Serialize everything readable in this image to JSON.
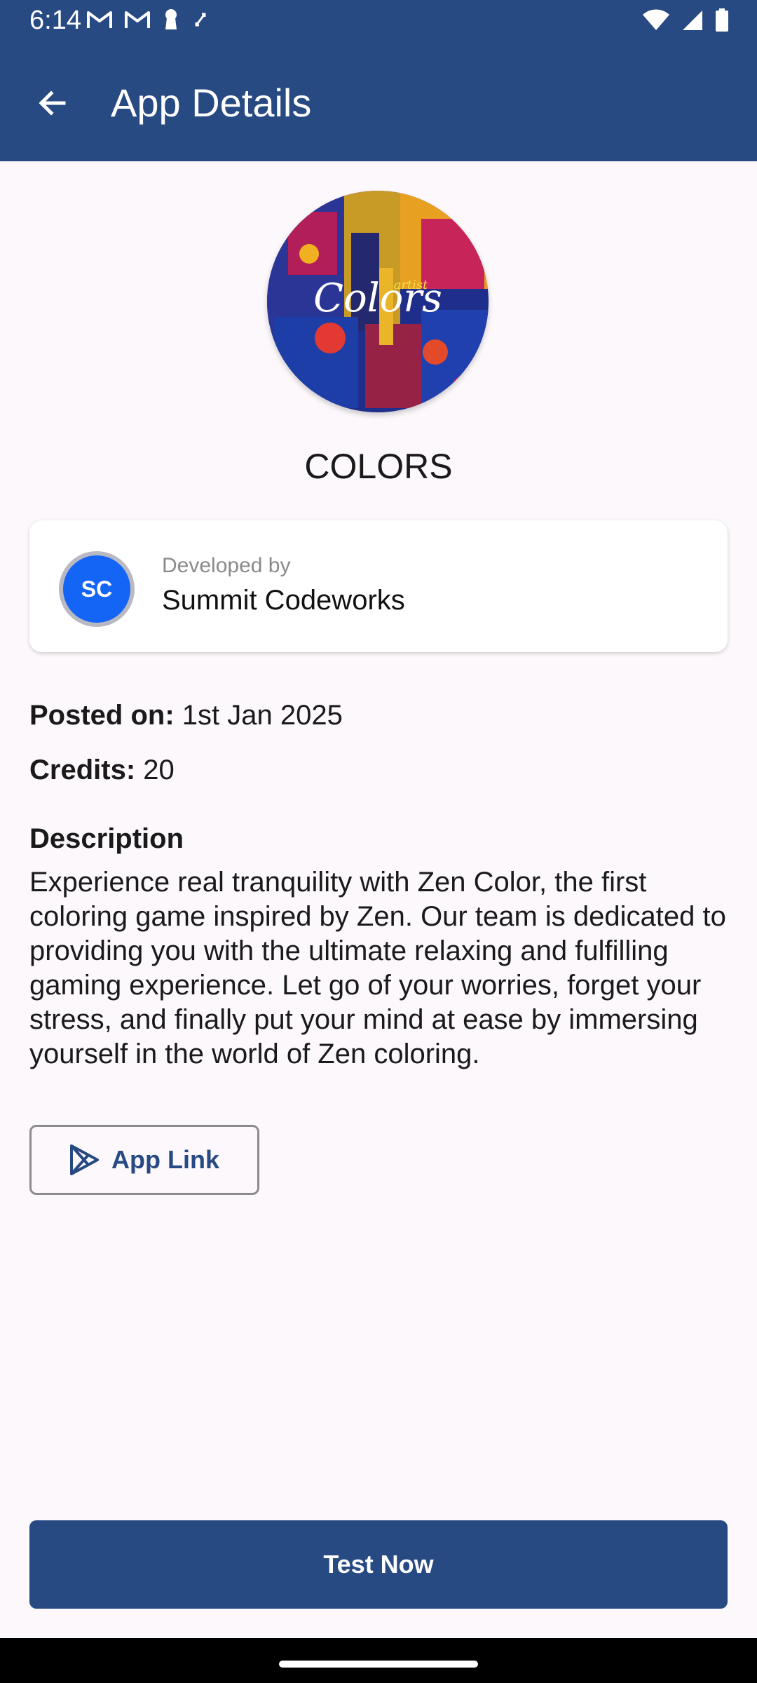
{
  "status": {
    "time": "6:14"
  },
  "appbar": {
    "title": "App Details"
  },
  "app": {
    "name": "COLORS",
    "logo_text": "Colors",
    "logo_subtext": "artist"
  },
  "developer": {
    "label": "Developed by",
    "name": "Summit Codeworks",
    "initials": "SC"
  },
  "meta": {
    "posted_label": "Posted on:",
    "posted_value": "1st Jan 2025",
    "credits_label": "Credits:",
    "credits_value": "20"
  },
  "description": {
    "title": "Description",
    "text": "Experience real tranquility with Zen Color, the first coloring game inspired by Zen. Our team is dedicated to providing you with the ultimate relaxing and fulfilling gaming experience. Let go of your worries, forget your stress, and finally put your mind at ease by immersing yourself in the world of Zen coloring."
  },
  "buttons": {
    "app_link": "App Link",
    "test_now": "Test Now"
  },
  "colors": {
    "primary": "#284a82",
    "avatar": "#1464f5",
    "background": "#fcf8fc"
  },
  "icons": {
    "back": "arrow-left-icon",
    "play_store": "play-store-icon",
    "wifi": "wifi-icon",
    "signal": "signal-icon",
    "battery": "battery-icon",
    "gmail": "gmail-icon"
  }
}
